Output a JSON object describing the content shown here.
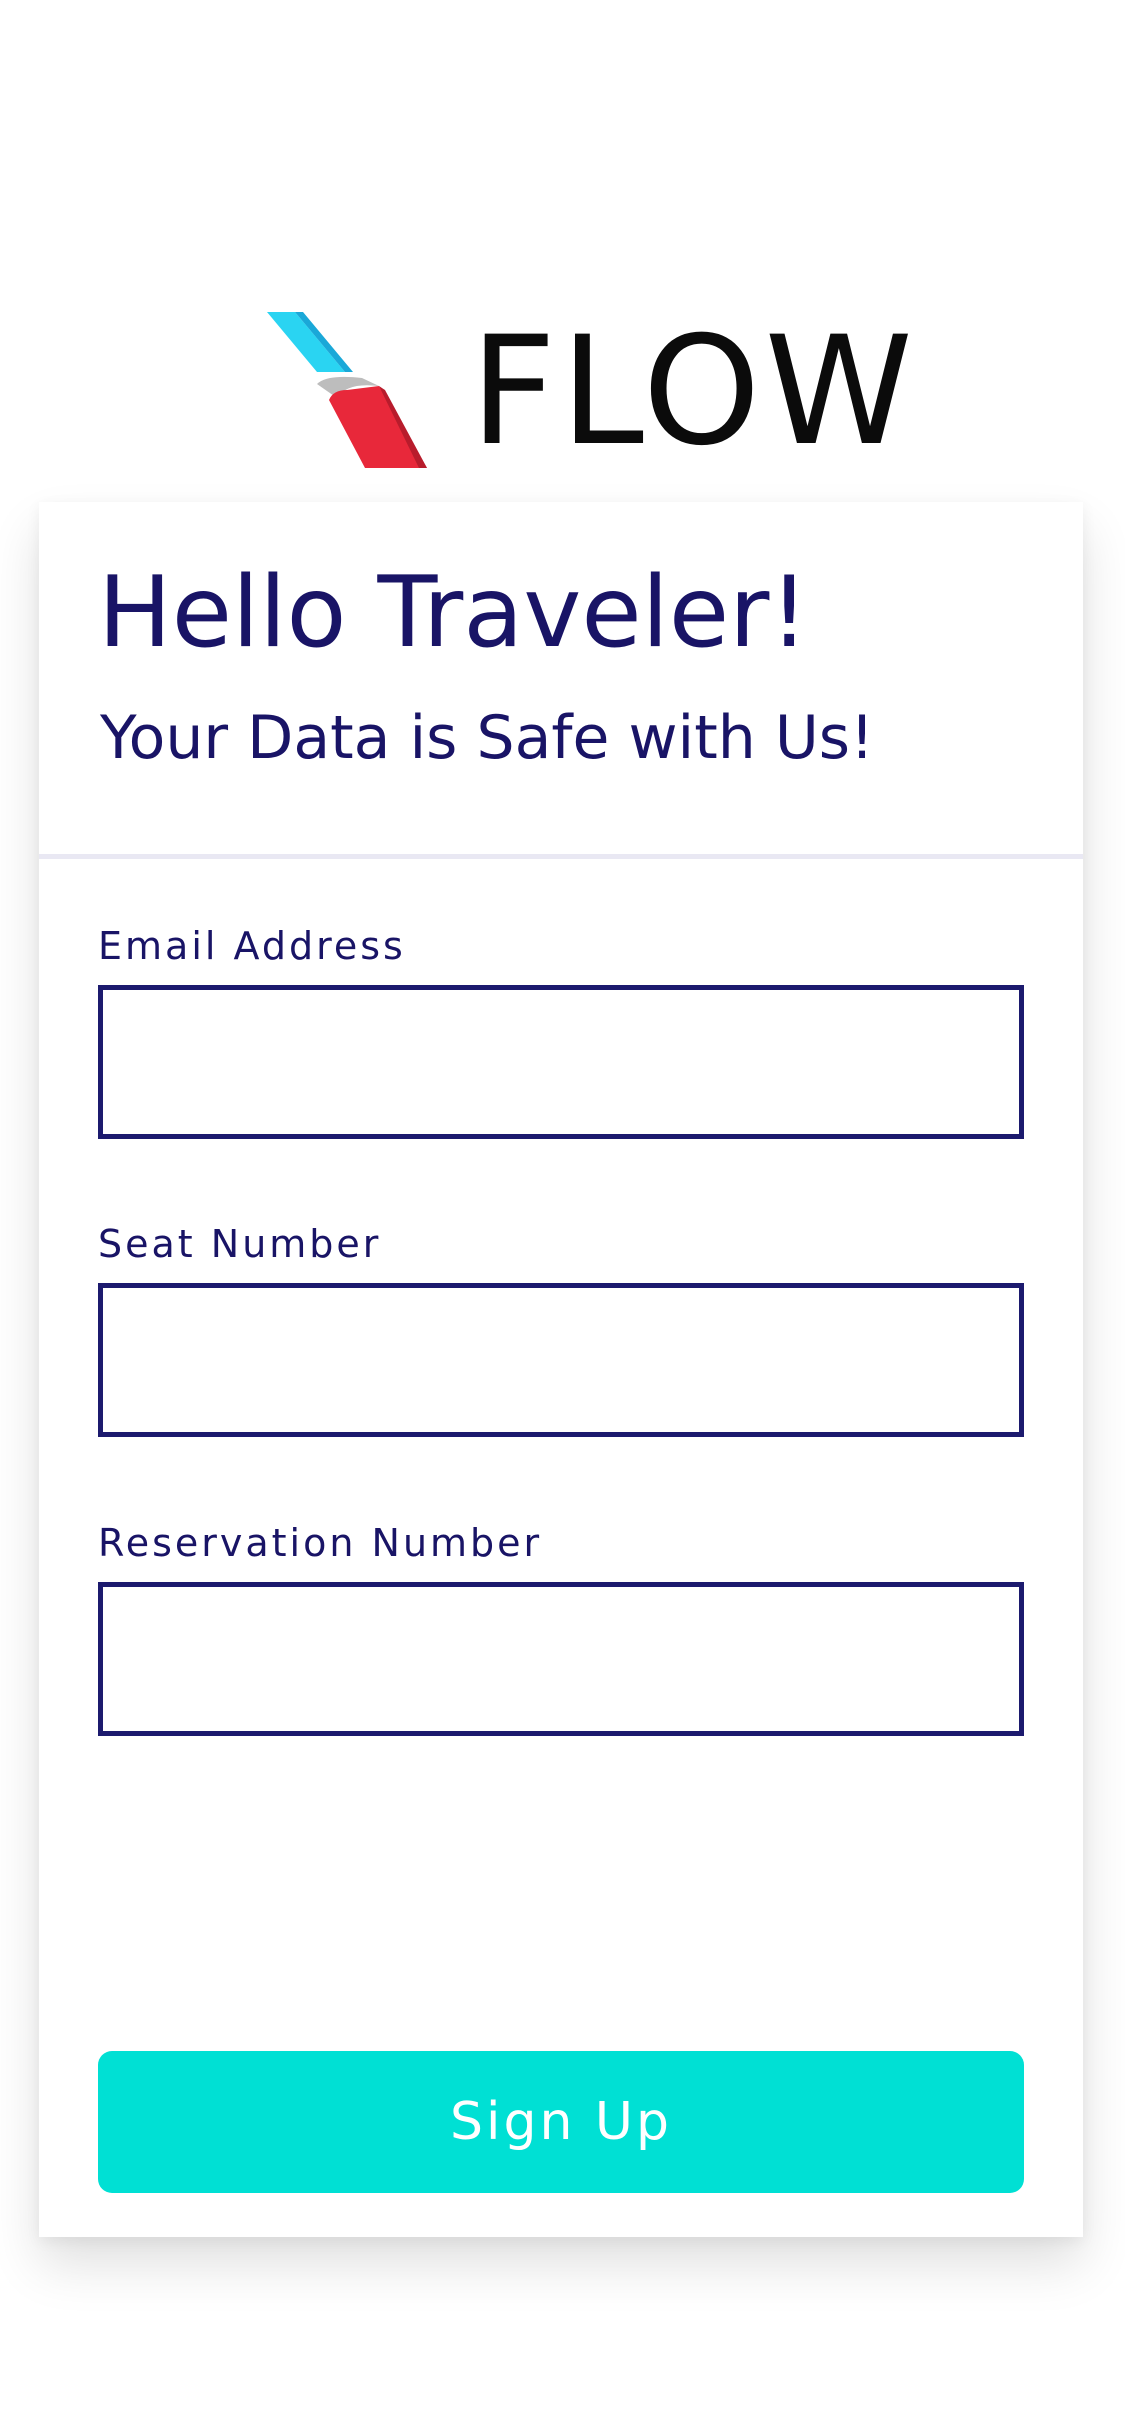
{
  "logo": {
    "icon": "tail-fin-icon",
    "text": "FLOW"
  },
  "header": {
    "greeting": "Hello Traveler!",
    "subtitle": "Your Data is Safe with Us!"
  },
  "form": {
    "fields": [
      {
        "label": "Email Address",
        "value": "",
        "placeholder": ""
      },
      {
        "label": "Seat Number",
        "value": "",
        "placeholder": ""
      },
      {
        "label": "Reservation Number",
        "value": "",
        "placeholder": ""
      }
    ],
    "submit_label": "Sign Up"
  },
  "colors": {
    "primary_text": "#191466",
    "input_border": "#1c1a6e",
    "button": "#00e0d4",
    "logo_cyan": "#2ad4f2",
    "logo_red": "#e8283a",
    "logo_gray": "#bdbdbd"
  }
}
